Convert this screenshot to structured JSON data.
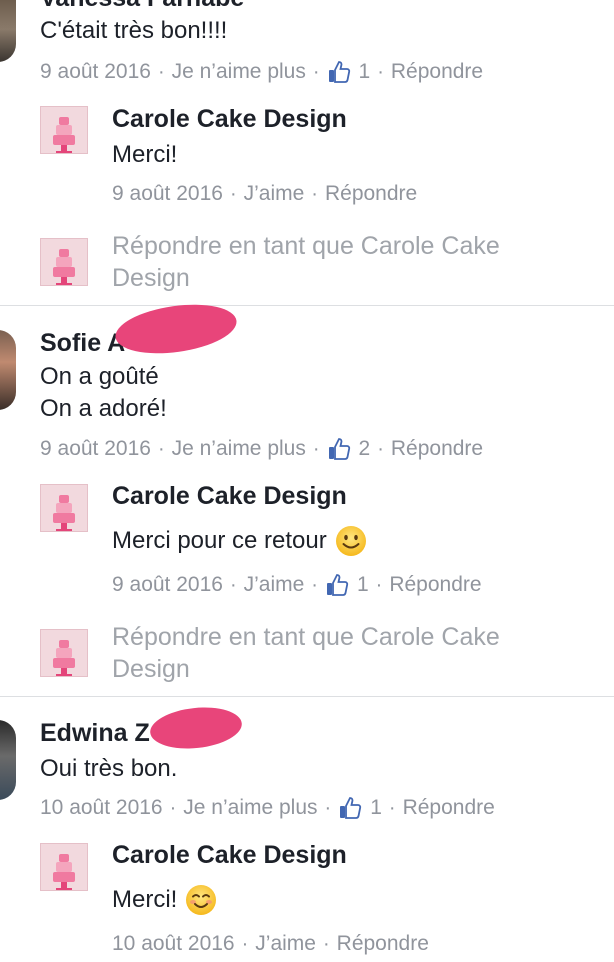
{
  "comments": [
    {
      "author": "Vanessa Farnabé",
      "text": "C'était très bon!!!!",
      "date": "9 août 2016",
      "like_action": "Je n’aime plus",
      "like_count": "1",
      "reply": "Répondre",
      "page_reply": {
        "author": "Carole Cake Design",
        "text": "Merci!",
        "date": "9 août 2016",
        "like_action": "J’aime",
        "reply": "Répondre"
      },
      "reply_as": "Répondre en tant que Carole Cake Design"
    },
    {
      "author": "Sofie A",
      "text_line1": "On a goûté",
      "text_line2": "On a adoré!",
      "date": "9 août 2016",
      "like_action": "Je n’aime plus",
      "like_count": "2",
      "reply": "Répondre",
      "page_reply": {
        "author": "Carole Cake Design",
        "text": "Merci pour ce retour",
        "emoji": "smiley-icon",
        "date": "9 août 2016",
        "like_action": "J’aime",
        "like_count": "1",
        "reply": "Répondre"
      },
      "reply_as": "Répondre en tant que Carole Cake Design"
    },
    {
      "author": "Edwina Z",
      "text": "Oui très bon.",
      "date": "10 août 2016",
      "like_action": "Je n’aime plus",
      "like_count": "1",
      "reply": "Répondre",
      "page_reply": {
        "author": "Carole Cake Design",
        "text": "Merci!",
        "emoji": "blush-smiley-icon",
        "date": "10 août 2016",
        "like_action": "J’aime",
        "reply": "Répondre"
      }
    }
  ],
  "colors": {
    "text": "#1d2129",
    "meta": "#90949c",
    "like_blue": "#4267b2",
    "redaction": "#e8457a",
    "divider": "#dddfe2"
  }
}
